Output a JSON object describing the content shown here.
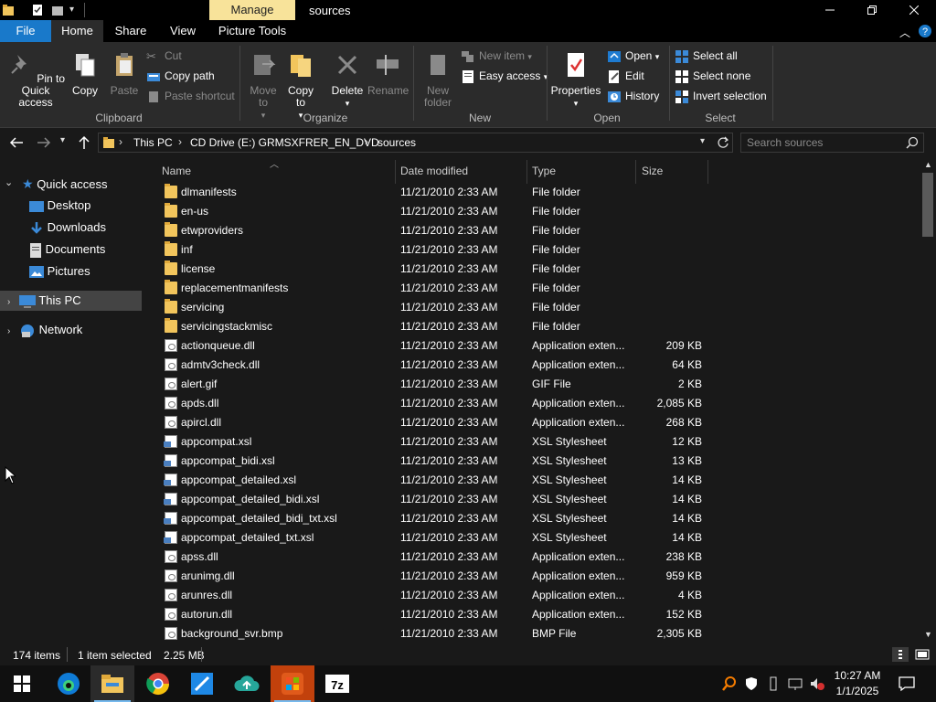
{
  "title_bar": {
    "manage_tab": "Manage",
    "window_title": "sources"
  },
  "tabs": {
    "file": "File",
    "home": "Home",
    "share": "Share",
    "view": "View",
    "picture_tools": "Picture Tools"
  },
  "ribbon": {
    "clipboard": {
      "pin_to_quick_access": "Pin to Quick access",
      "copy": "Copy",
      "paste": "Paste",
      "cut": "Cut",
      "copy_path": "Copy path",
      "paste_shortcut": "Paste shortcut",
      "group": "Clipboard"
    },
    "organize": {
      "move_to": "Move to",
      "copy_to": "Copy to",
      "delete": "Delete",
      "rename": "Rename",
      "group": "Organize"
    },
    "new": {
      "new_folder": "New folder",
      "new_item": "New item",
      "easy_access": "Easy access",
      "group": "New"
    },
    "open": {
      "properties": "Properties",
      "open": "Open",
      "edit": "Edit",
      "history": "History",
      "group": "Open"
    },
    "select": {
      "select_all": "Select all",
      "select_none": "Select none",
      "invert_selection": "Invert selection",
      "group": "Select"
    }
  },
  "address_bar": {
    "crumbs": [
      "This PC",
      "CD Drive (E:) GRMSXFRER_EN_DVD",
      "sources"
    ],
    "search_placeholder": "Search sources"
  },
  "nav_pane": {
    "quick_access": "Quick access",
    "desktop": "Desktop",
    "downloads": "Downloads",
    "documents": "Documents",
    "pictures": "Pictures",
    "this_pc": "This PC",
    "network": "Network"
  },
  "columns": {
    "name": "Name",
    "date_modified": "Date modified",
    "type": "Type",
    "size": "Size"
  },
  "files": [
    {
      "name": "dlmanifests",
      "date": "11/21/2010 2:33 AM",
      "type": "File folder",
      "size": "",
      "icon": "folder"
    },
    {
      "name": "en-us",
      "date": "11/21/2010 2:33 AM",
      "type": "File folder",
      "size": "",
      "icon": "folder"
    },
    {
      "name": "etwproviders",
      "date": "11/21/2010 2:33 AM",
      "type": "File folder",
      "size": "",
      "icon": "folder"
    },
    {
      "name": "inf",
      "date": "11/21/2010 2:33 AM",
      "type": "File folder",
      "size": "",
      "icon": "folder"
    },
    {
      "name": "license",
      "date": "11/21/2010 2:33 AM",
      "type": "File folder",
      "size": "",
      "icon": "folder"
    },
    {
      "name": "replacementmanifests",
      "date": "11/21/2010 2:33 AM",
      "type": "File folder",
      "size": "",
      "icon": "folder"
    },
    {
      "name": "servicing",
      "date": "11/21/2010 2:33 AM",
      "type": "File folder",
      "size": "",
      "icon": "folder"
    },
    {
      "name": "servicingstackmisc",
      "date": "11/21/2010 2:33 AM",
      "type": "File folder",
      "size": "",
      "icon": "folder"
    },
    {
      "name": "actionqueue.dll",
      "date": "11/21/2010 2:33 AM",
      "type": "Application exten...",
      "size": "209 KB",
      "icon": "file"
    },
    {
      "name": "admtv3check.dll",
      "date": "11/21/2010 2:33 AM",
      "type": "Application exten...",
      "size": "64 KB",
      "icon": "file"
    },
    {
      "name": "alert.gif",
      "date": "11/21/2010 2:33 AM",
      "type": "GIF File",
      "size": "2 KB",
      "icon": "file"
    },
    {
      "name": "apds.dll",
      "date": "11/21/2010 2:33 AM",
      "type": "Application exten...",
      "size": "2,085 KB",
      "icon": "file"
    },
    {
      "name": "apircl.dll",
      "date": "11/21/2010 2:33 AM",
      "type": "Application exten...",
      "size": "268 KB",
      "icon": "file"
    },
    {
      "name": "appcompat.xsl",
      "date": "11/21/2010 2:33 AM",
      "type": "XSL Stylesheet",
      "size": "12 KB",
      "icon": "xsl"
    },
    {
      "name": "appcompat_bidi.xsl",
      "date": "11/21/2010 2:33 AM",
      "type": "XSL Stylesheet",
      "size": "13 KB",
      "icon": "xsl"
    },
    {
      "name": "appcompat_detailed.xsl",
      "date": "11/21/2010 2:33 AM",
      "type": "XSL Stylesheet",
      "size": "14 KB",
      "icon": "xsl"
    },
    {
      "name": "appcompat_detailed_bidi.xsl",
      "date": "11/21/2010 2:33 AM",
      "type": "XSL Stylesheet",
      "size": "14 KB",
      "icon": "xsl"
    },
    {
      "name": "appcompat_detailed_bidi_txt.xsl",
      "date": "11/21/2010 2:33 AM",
      "type": "XSL Stylesheet",
      "size": "14 KB",
      "icon": "xsl"
    },
    {
      "name": "appcompat_detailed_txt.xsl",
      "date": "11/21/2010 2:33 AM",
      "type": "XSL Stylesheet",
      "size": "14 KB",
      "icon": "xsl"
    },
    {
      "name": "apss.dll",
      "date": "11/21/2010 2:33 AM",
      "type": "Application exten...",
      "size": "238 KB",
      "icon": "file"
    },
    {
      "name": "arunimg.dll",
      "date": "11/21/2010 2:33 AM",
      "type": "Application exten...",
      "size": "959 KB",
      "icon": "file"
    },
    {
      "name": "arunres.dll",
      "date": "11/21/2010 2:33 AM",
      "type": "Application exten...",
      "size": "4 KB",
      "icon": "file"
    },
    {
      "name": "autorun.dll",
      "date": "11/21/2010 2:33 AM",
      "type": "Application exten...",
      "size": "152 KB",
      "icon": "file"
    },
    {
      "name": "background_svr.bmp",
      "date": "11/21/2010 2:33 AM",
      "type": "BMP File",
      "size": "2,305 KB",
      "icon": "file"
    }
  ],
  "status_bar": {
    "item_count": "174 items",
    "selection": "1 item selected",
    "selection_size": "2.25 MB"
  },
  "taskbar": {
    "apps": [
      "start-icon",
      "edge-icon",
      "file-explorer-icon",
      "chrome-icon",
      "paint-icon",
      "upload-app-icon",
      "windows-installer-icon",
      "7zip-icon"
    ],
    "time": "10:27 AM",
    "date": "1/1/2025"
  },
  "colors": {
    "file_tab": "#1979ca",
    "manage_tab": "#f8e39a",
    "background": "#191919",
    "ribbon": "#2b2b2b"
  }
}
